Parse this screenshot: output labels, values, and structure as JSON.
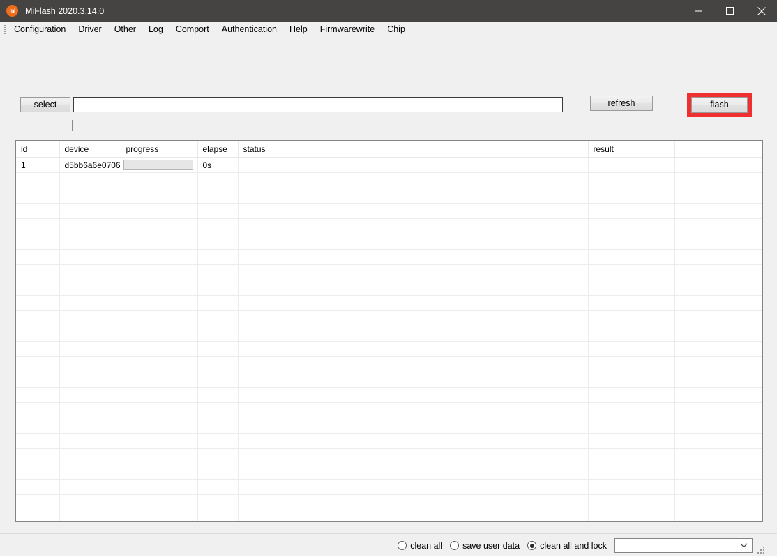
{
  "window": {
    "title": "MiFlash 2020.3.14.0",
    "icon_label": "mi",
    "icon_name": "mi-logo-icon",
    "controls": {
      "minimize": "minimize-icon",
      "maximize": "maximize-icon",
      "close": "close-icon"
    },
    "titlebar_color": "#464442"
  },
  "menubar": {
    "items": [
      {
        "label": "Configuration"
      },
      {
        "label": "Driver"
      },
      {
        "label": "Other"
      },
      {
        "label": "Log"
      },
      {
        "label": "Comport"
      },
      {
        "label": "Authentication"
      },
      {
        "label": "Help"
      },
      {
        "label": "Firmwarewrite"
      },
      {
        "label": "Chip"
      }
    ]
  },
  "toolbar": {
    "select_label": "select",
    "path_value": "",
    "path_placeholder": "",
    "refresh_label": "refresh",
    "flash_label": "flash",
    "flash_highlight_color": "#f03030"
  },
  "table": {
    "headers": [
      "id",
      "device",
      "progress",
      "elapse",
      "status",
      "result",
      ""
    ],
    "rows": [
      {
        "id": "1",
        "device": "d5bb6a6e0706",
        "progress": "",
        "progress_percent": 0,
        "elapse": "0s",
        "status": "",
        "result": "",
        "extra": ""
      }
    ],
    "empty_row_count": 25
  },
  "bottom": {
    "options": [
      {
        "label": "clean all",
        "selected": false
      },
      {
        "label": "save user data",
        "selected": false
      },
      {
        "label": "clean all and lock",
        "selected": true
      }
    ],
    "combo_value": "",
    "combo_icon": "chevron-down-icon",
    "resize_grip": "resize-grip-icon"
  }
}
